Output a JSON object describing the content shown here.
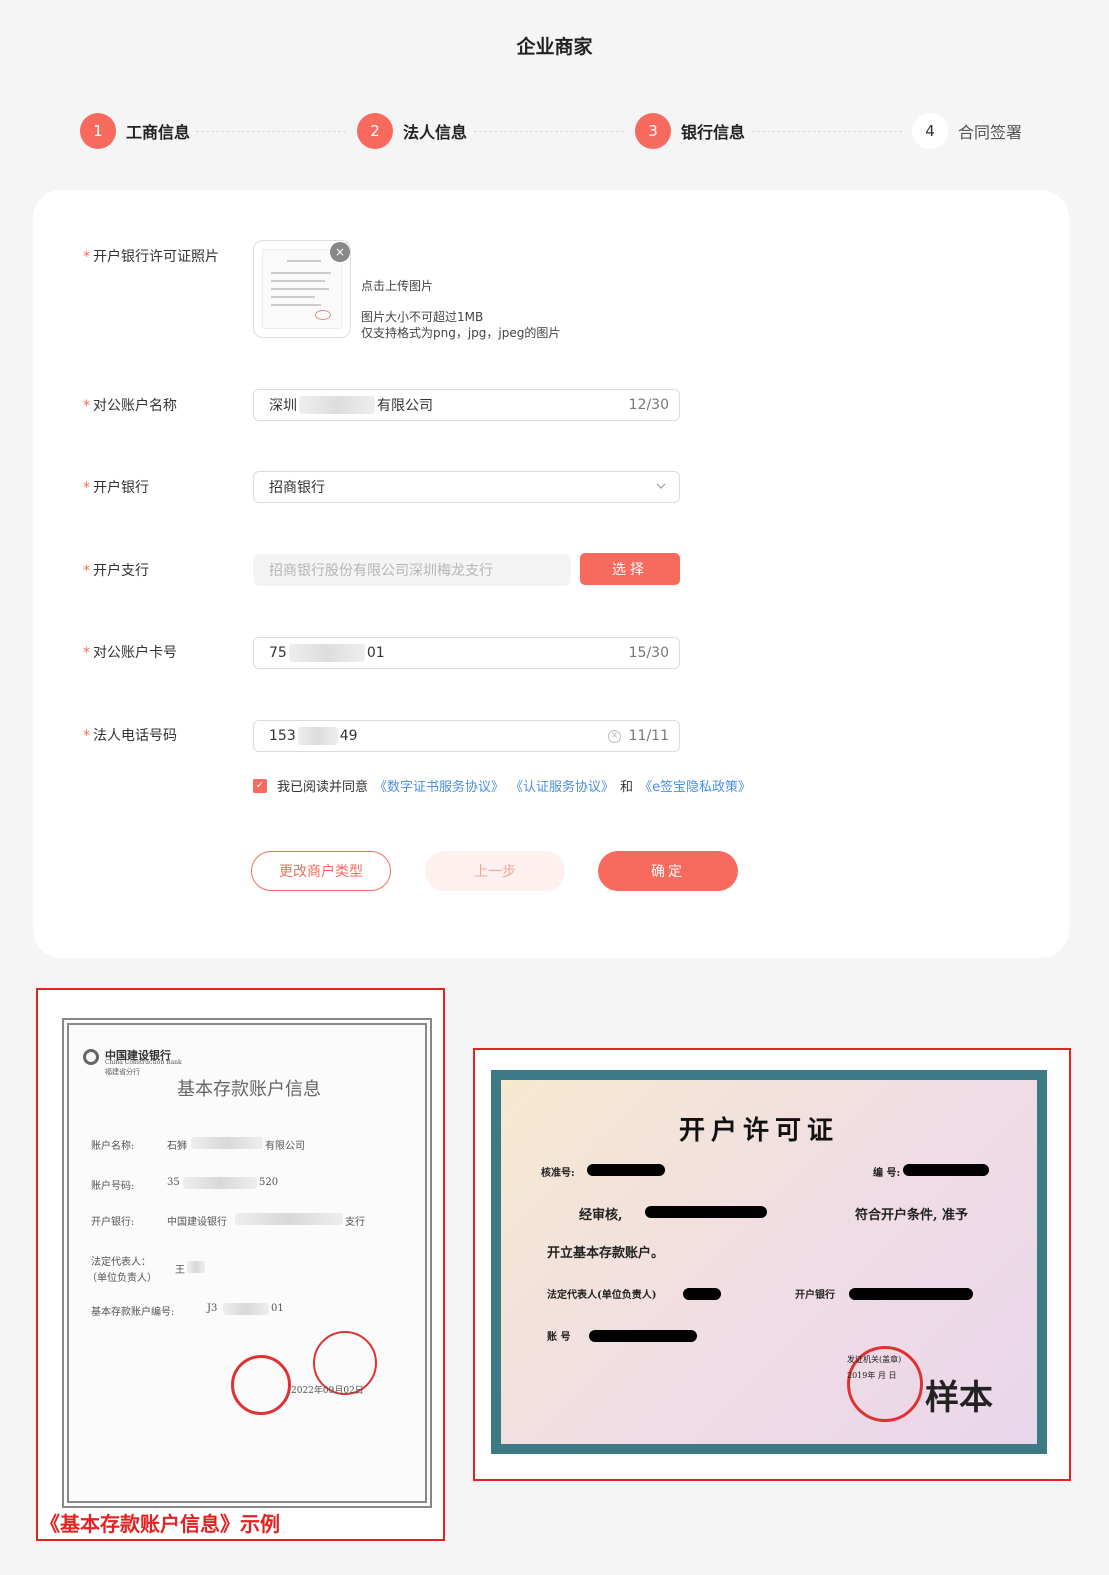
{
  "page": {
    "title": "企业商家"
  },
  "steps": [
    {
      "num": "1",
      "label": "工商信息",
      "state": "done"
    },
    {
      "num": "2",
      "label": "法人信息",
      "state": "done"
    },
    {
      "num": "3",
      "label": "银行信息",
      "state": "done"
    },
    {
      "num": "4",
      "label": "合同签署",
      "state": "todo"
    }
  ],
  "colors": {
    "accent": "#f86a5e",
    "link": "#4a8ee0",
    "frame": "#e52222"
  },
  "form": {
    "license_photo": {
      "label": "开户银行许可证照片",
      "close_icon": "×",
      "hint_upload": "点击上传图片",
      "hint_size": "图片大小不可超过1MB",
      "hint_format": "仅支持格式为png，jpg，jpeg的图片"
    },
    "account_name": {
      "label": "对公账户名称",
      "value_prefix": "深圳",
      "value_suffix": "有限公司",
      "counter": "12/30"
    },
    "bank": {
      "label": "开户银行",
      "value": "招商银行"
    },
    "branch": {
      "label": "开户支行",
      "value": "招商银行股份有限公司深圳梅龙支行",
      "button": "选择"
    },
    "account_no": {
      "label": "对公账户卡号",
      "value_prefix": "75",
      "value_suffix": "01",
      "counter": "15/30"
    },
    "phone": {
      "label": "法人电话号码",
      "value_prefix": "153",
      "value_suffix": "49",
      "counter": "11/11"
    },
    "required_mark": "*"
  },
  "agreement": {
    "text": "我已阅读并同意",
    "link1": "《数字证书服务协议》",
    "link2": "《认证服务协议》",
    "and": "和",
    "link3": "《e签宝隐私政策》"
  },
  "buttons": {
    "change_type": "更改商户类型",
    "prev": "上一步",
    "confirm": "确定"
  },
  "example_left": {
    "bank_name": "中国建设银行",
    "bank_name_en": "China Construction Bank",
    "branch_name": "福建省分行",
    "doc_title": "基本存款账户信息",
    "field_name": "账户名称:",
    "field_name_value_prefix": "石狮",
    "field_name_value_suffix": "有限公司",
    "field_no": "账户号码:",
    "field_no_value_prefix": "35",
    "field_no_value_suffix": "520",
    "field_bank": "开户银行:",
    "field_bank_value_prefix": "中国建设银行",
    "field_bank_value_suffix": "支行",
    "field_rep": "法定代表人：",
    "field_rep_sub": "（单位负责人）",
    "field_rep_value": "王",
    "field_basic_no": "基本存款账户编号:",
    "field_basic_no_value_prefix": "J3",
    "field_basic_no_value_suffix": "01",
    "date": "2022年09月02日",
    "caption": "《基本存款账户信息》示例"
  },
  "example_right": {
    "title": "开户许可证",
    "approval_no": "核准号:",
    "serial_no": "编 号:",
    "reviewed": "经审核,",
    "qualified": "符合开户条件, 准予",
    "open": "开立基本存款账户。",
    "rep": "法定代表人(单位负责人)",
    "bank": "开户银行",
    "account": "账  号",
    "issuer": "发证机关(盖章)",
    "issue_date": "2019年  月  日",
    "sample": "样本"
  }
}
